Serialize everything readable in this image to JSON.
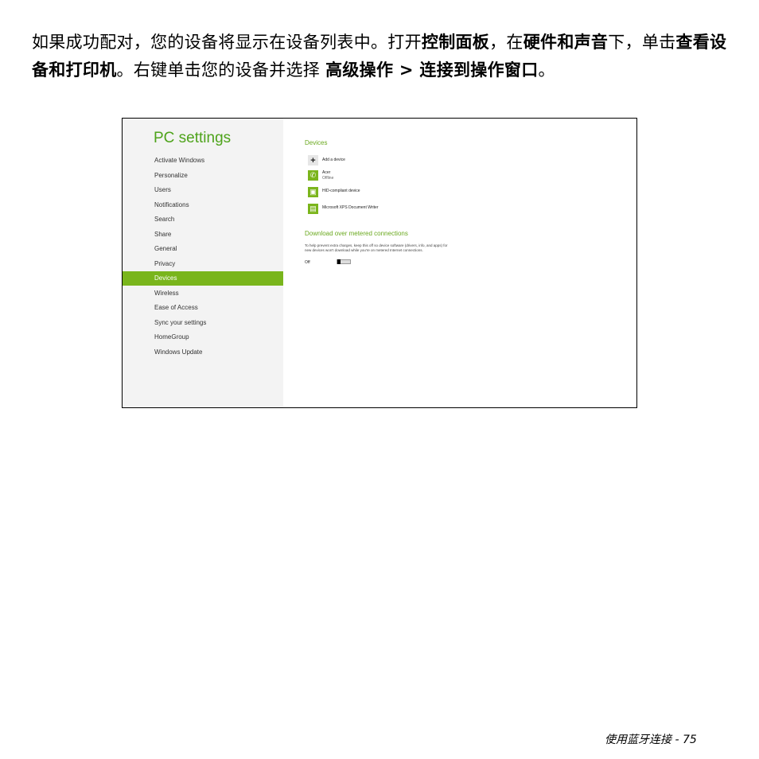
{
  "instruction": {
    "t1": "如果成功配对，您的设备将显示在设备列表中。打开",
    "b1": "控制面板",
    "t2": "，在",
    "b2": "硬件和声音",
    "t3": "下，单击",
    "b3": "查看设备和打印机",
    "t4": "。右键单击您的设备并选择 ",
    "b4": "高级操作 > 连接到操作窗口",
    "t5": "。"
  },
  "screenshot": {
    "sidebar": {
      "title": "PC settings",
      "items": [
        "Activate Windows",
        "Personalize",
        "Users",
        "Notifications",
        "Search",
        "Share",
        "General",
        "Privacy",
        "Devices",
        "Wireless",
        "Ease of Access",
        "Sync your settings",
        "HomeGroup",
        "Windows Update"
      ],
      "active_item": "Devices"
    },
    "devices": {
      "title": "Devices",
      "add_label": "Add a device",
      "list": [
        {
          "name": "Acer",
          "status": "Offline",
          "icon": "phone-icon"
        },
        {
          "name": "HID-compliant device",
          "status": "",
          "icon": "hid-device-icon"
        },
        {
          "name": "Microsoft XPS Document Writer",
          "status": "",
          "icon": "printer-icon"
        }
      ]
    },
    "download": {
      "title": "Download over metered connections",
      "description": "To help prevent extra charges, keep this off so device software (drivers, info, and apps) for new devices won't download while you're on metered Internet connections.",
      "toggle_label": "Off"
    },
    "colors": {
      "accent": "#79b51c",
      "sidebar_bg": "#f3f3f3"
    }
  },
  "footer": {
    "text": "使用蓝牙连接 - 75"
  }
}
